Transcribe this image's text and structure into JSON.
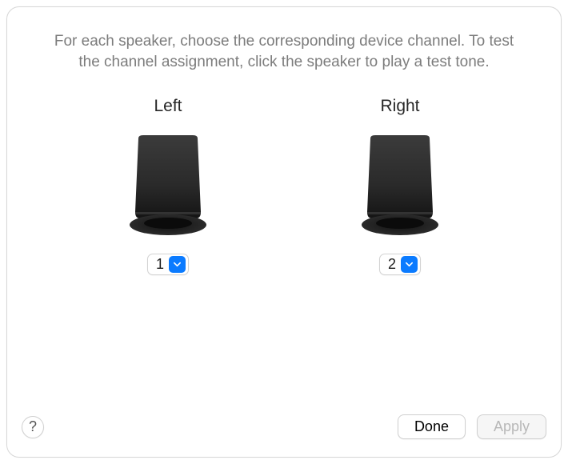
{
  "instructions": "For each speaker, choose the corresponding device channel. To test the channel assignment, click the speaker to play a test tone.",
  "speakers": {
    "left": {
      "label": "Left",
      "channel": "1"
    },
    "right": {
      "label": "Right",
      "channel": "2"
    }
  },
  "buttons": {
    "help": "?",
    "done": "Done",
    "apply": "Apply"
  },
  "colors": {
    "accent": "#0b7bff"
  }
}
